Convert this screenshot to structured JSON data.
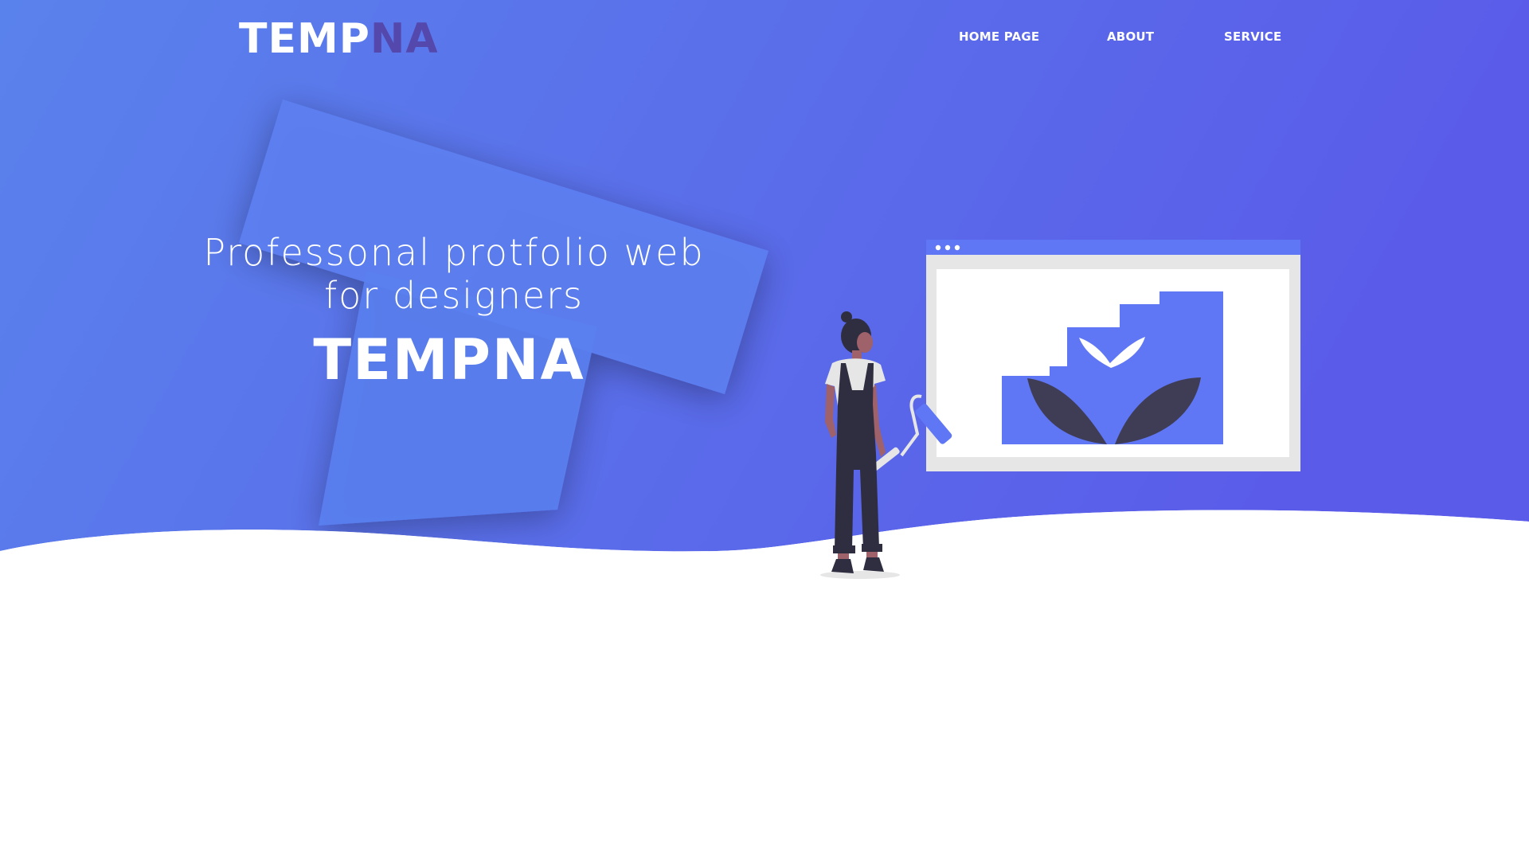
{
  "colors": {
    "gradient_start": "#5a82ec",
    "gradient_end": "#5a5ce8",
    "accent_dark": "#5548ad",
    "illustration_dark": "#3f3d56",
    "illustration_blue": "#5f77f5"
  },
  "header": {
    "logo_part1": "TEMP",
    "logo_part2": "NA",
    "nav": {
      "home": "HOME PAGE",
      "about": "ABOUT",
      "service": "SERVICE"
    }
  },
  "hero": {
    "headline_line1": "Professonal protfolio web",
    "headline_line2": "for designers",
    "brand": "TEMPNA"
  },
  "icons": {
    "illustration": "woman-painting-browser-illustration"
  }
}
